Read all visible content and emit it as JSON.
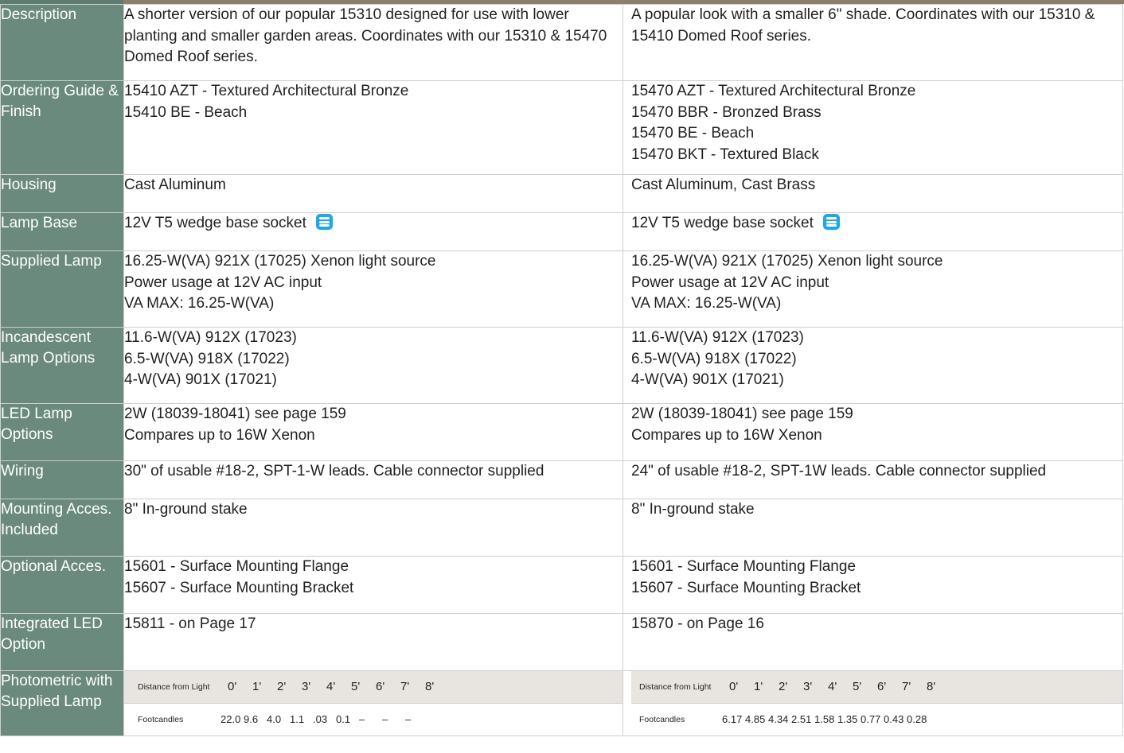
{
  "rows": [
    {
      "label": "Description",
      "col1": [
        "A shorter version of our popular 15310 designed for use with lower planting and smaller garden areas. Coordinates with our 15310 & 15470 Domed Roof series."
      ],
      "col2": [
        "A popular look with a smaller 6\" shade. Coordinates with our 15310 & 15410 Domed Roof series."
      ]
    },
    {
      "label": "Ordering Guide & Finish",
      "col1": [
        "15410 AZT - Textured Architectural Bronze",
        "15410 BE - Beach"
      ],
      "col2": [
        "15470 AZT - Textured Architectural Bronze",
        "15470 BBR - Bronzed Brass",
        "15470 BE - Beach",
        "15470 BKT - Textured Black"
      ]
    },
    {
      "label": "Housing",
      "col1": [
        "Cast Aluminum"
      ],
      "col2": [
        "Cast Aluminum, Cast Brass"
      ]
    },
    {
      "label": "Lamp Base",
      "col1": [
        "12V  T5 wedge base socket"
      ],
      "col2": [
        "12V  T5 wedge base socket"
      ]
    },
    {
      "label": "Supplied Lamp",
      "col1": [
        "16.25-W(VA) 921X (17025) Xenon light source",
        "Power usage at 12V AC input",
        "VA MAX: 16.25-W(VA)"
      ],
      "col2": [
        "16.25-W(VA) 921X (17025) Xenon light source",
        "Power usage at 12V AC input",
        "VA MAX: 16.25-W(VA)"
      ]
    },
    {
      "label": "Incandescent Lamp Options",
      "col1": [
        "11.6-W(VA) 912X (17023)",
        "6.5-W(VA) 918X (17022)",
        "4-W(VA) 901X (17021)"
      ],
      "col2": [
        "11.6-W(VA) 912X (17023)",
        "6.5-W(VA) 918X (17022)",
        "4-W(VA) 901X (17021)"
      ]
    },
    {
      "label": "LED Lamp Options",
      "col1": [
        "2W (18039-18041) see page 159",
        "Compares up to 16W Xenon"
      ],
      "col2": [
        "2W (18039-18041) see page 159",
        "Compares up to 16W Xenon"
      ]
    },
    {
      "label": "Wiring",
      "col1": [
        "30\" of usable #18-2, SPT-1-W leads. Cable connector supplied"
      ],
      "col2": [
        "24\" of usable #18-2, SPT-1W leads. Cable connector supplied"
      ]
    },
    {
      "label": "Mounting Acces. Included",
      "col1": [
        "8\" In-ground stake"
      ],
      "col2": [
        "8\" In-ground stake"
      ]
    },
    {
      "label": "Optional Acces.",
      "col1": [
        "15601 - Surface Mounting Flange",
        "15607 - Surface Mounting Bracket"
      ],
      "col2": [
        "15601 - Surface Mounting Flange",
        "15607 - Surface Mounting Bracket"
      ]
    },
    {
      "label": "Integrated LED Option",
      "col1": [
        "15811 - on Page 17"
      ],
      "col2": [
        "15870 - on Page 16"
      ]
    }
  ],
  "photometric": {
    "label": "Photometric with Supplied Lamp",
    "distance_label": "Distance from Light",
    "footcandles_label": "Footcandles",
    "distances": [
      "0'",
      "1'",
      "2'",
      "3'",
      "4'",
      "5'",
      "6'",
      "7'",
      "8'"
    ],
    "col1_footcandles": [
      "22.0",
      "9.6",
      "4.0",
      "1.1",
      ".03",
      "0.1",
      "–",
      "–",
      "–"
    ],
    "col2_footcandles": [
      "6.17",
      "4.85",
      "4.34",
      "2.51",
      "1.58",
      "1.35",
      "0.77",
      "0.43",
      "0.28"
    ]
  },
  "colors": {
    "label_bg": "#6a8a7d",
    "photometric_band": "#e8e5e1",
    "socket_icon": "#1fa7e6"
  },
  "icons": {
    "socket": "wedge-socket-icon"
  }
}
